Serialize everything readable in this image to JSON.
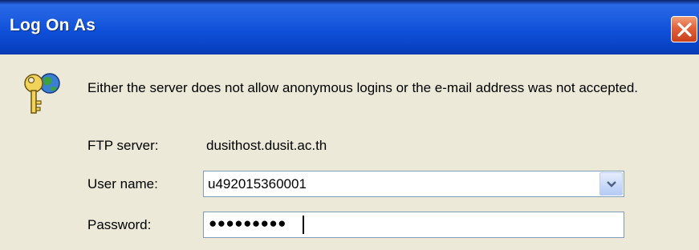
{
  "window": {
    "title": "Log On As",
    "close_icon": "close-icon",
    "colors": {
      "titlebar": "#0f4fd8",
      "close": "#e2613c",
      "background": "#ece9d8"
    }
  },
  "dialog": {
    "icon": "key-globe-icon",
    "message": "Either the server does not allow anonymous logins or the e-mail address was not accepted.",
    "ftp_server_label": "FTP server:",
    "ftp_server_value": "dusithost.dusit.ac.th",
    "username_label": "User name:",
    "username_value": "u492015360001",
    "password_label": "Password:",
    "password_masked": "●●●●●●●●●"
  }
}
